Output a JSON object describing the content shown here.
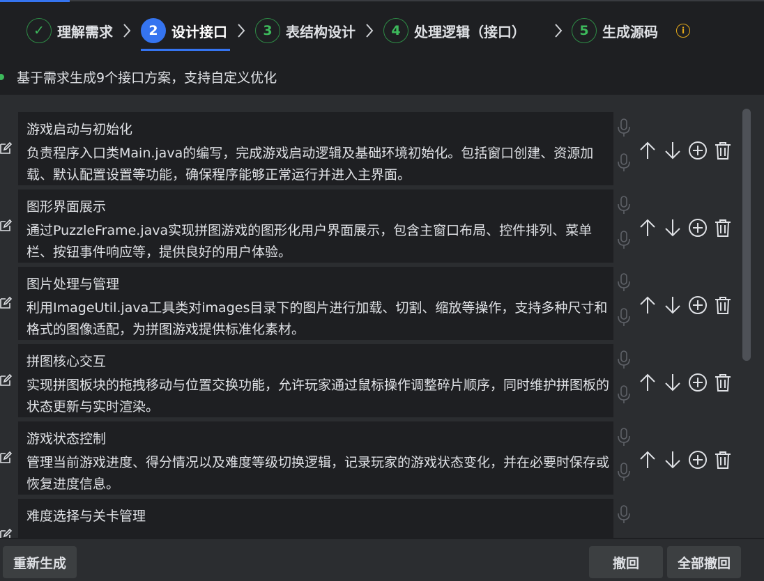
{
  "steps": [
    {
      "num": "✓",
      "label": "理解需求",
      "state": "done"
    },
    {
      "num": "2",
      "label": "设计接口",
      "state": "active"
    },
    {
      "num": "3",
      "label": "表结构设计",
      "state": "pending"
    },
    {
      "num": "4",
      "label": "处理逻辑（接口）",
      "state": "pending"
    },
    {
      "num": "5",
      "label": "生成源码",
      "state": "pending"
    }
  ],
  "info_icon": "i",
  "subtitle": "基于需求生成9个接口方案，支持自定义优化",
  "items": [
    {
      "title": "游戏启动与初始化",
      "desc": "负责程序入口类Main.java的编写，完成游戏启动逻辑及基础环境初始化。包括窗口创建、资源加载、默认配置设置等功能，确保程序能够正常运行并进入主界面。"
    },
    {
      "title": "图形界面展示",
      "desc": "通过PuzzleFrame.java实现拼图游戏的图形化用户界面展示，包含主窗口布局、控件排列、菜单栏、按钮事件响应等，提供良好的用户体验。"
    },
    {
      "title": "图片处理与管理",
      "desc": "利用ImageUtil.java工具类对images目录下的图片进行加载、切割、缩放等操作，支持多种尺寸和格式的图像适配，为拼图游戏提供标准化素材。"
    },
    {
      "title": "拼图核心交互",
      "desc": "实现拼图板块的拖拽移动与位置交换功能，允许玩家通过鼠标操作调整碎片顺序，同时维护拼图板的状态更新与实时渲染。"
    },
    {
      "title": "游戏状态控制",
      "desc": "管理当前游戏进度、得分情况以及难度等级切换逻辑，记录玩家的游戏状态变化，并在必要时保存或恢复进度信息。"
    },
    {
      "title": "难度选择与关卡管理",
      "desc": ""
    }
  ],
  "buttons": {
    "regenerate": "重新生成",
    "undo": "撤回",
    "undo_all": "全部撤回"
  },
  "colors": {
    "accent": "#3574f0",
    "success": "#3dba5c",
    "warning": "#e5a91a"
  }
}
